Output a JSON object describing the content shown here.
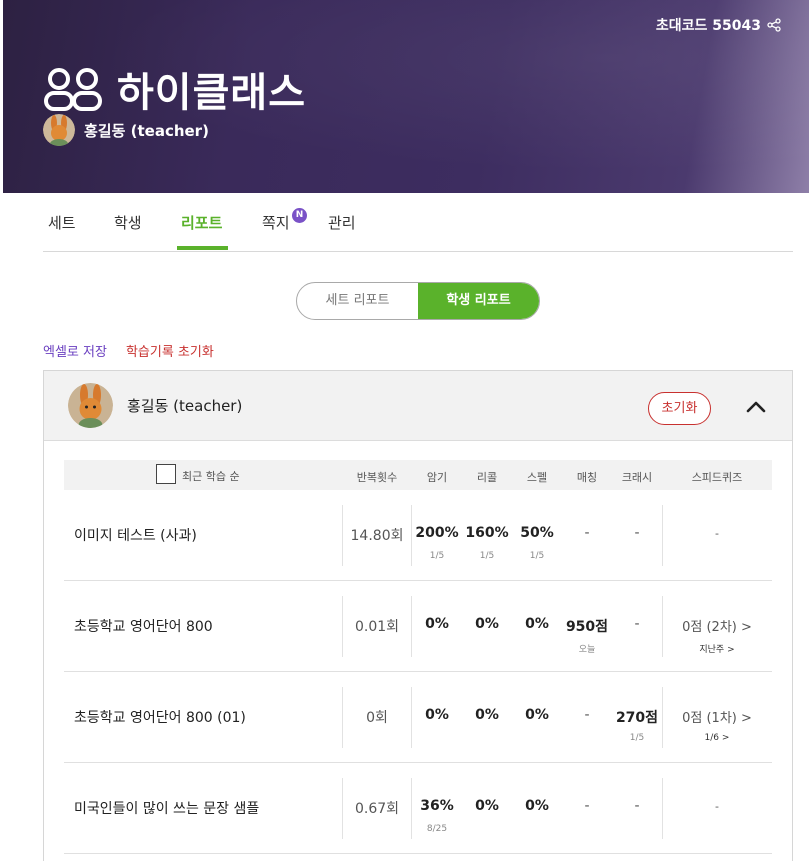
{
  "header": {
    "invite_label": "초대코드 55043",
    "brand": "하이클래스",
    "owner": "홍길동  (teacher)",
    "bg_color": "#3a2a5a"
  },
  "tabs": [
    {
      "label": "세트",
      "active": false
    },
    {
      "label": "학생",
      "active": false
    },
    {
      "label": "리포트",
      "active": true
    },
    {
      "label": "쪽지",
      "active": false,
      "badge": "N"
    },
    {
      "label": "관리",
      "active": false
    }
  ],
  "segment": {
    "set_report": "세트 리포트",
    "student_report": "학생 리포트",
    "active": "student_report"
  },
  "links": {
    "excel": "엑셀로 저장",
    "reset_records": "학습기록 초기화"
  },
  "student": {
    "name": "홍길동 (teacher)",
    "reset_button": "초기화"
  },
  "table": {
    "sort_label": "최근 학습 순",
    "columns": [
      "반복횟수",
      "암기",
      "리콜",
      "스펠",
      "매칭",
      "크래시",
      "스피드퀴즈"
    ],
    "rows": [
      {
        "title": "이미지 테스트 (사과)",
        "repeat": "14.80회",
        "memorize": "200%",
        "memorize_sub": "1/5",
        "recall": "160%",
        "recall_sub": "1/5",
        "spell": "50%",
        "spell_sub": "1/5",
        "matching": "-",
        "matching_sub": "",
        "crash": "-",
        "crash_sub": "",
        "speed": "-",
        "speed_sub": ""
      },
      {
        "title": "초등학교 영어단어 800",
        "repeat": "0.01회",
        "memorize": "0%",
        "memorize_sub": "",
        "recall": "0%",
        "recall_sub": "",
        "spell": "0%",
        "spell_sub": "",
        "matching": "950점",
        "matching_sub": "오늘",
        "crash": "-",
        "crash_sub": "",
        "speed": "0점 (2차) >",
        "speed_sub": "지난주 >"
      },
      {
        "title": "초등학교 영어단어 800 (01)",
        "repeat": "0회",
        "memorize": "0%",
        "memorize_sub": "",
        "recall": "0%",
        "recall_sub": "",
        "spell": "0%",
        "spell_sub": "",
        "matching": "-",
        "matching_sub": "",
        "crash": "270점",
        "crash_sub": "1/5",
        "speed": "0점 (1차) >",
        "speed_sub": "1/6 >"
      },
      {
        "title": "미국인들이 많이 쓰는 문장 샘플",
        "repeat": "0.67회",
        "memorize": "36%",
        "memorize_sub": "8/25",
        "recall": "0%",
        "recall_sub": "",
        "spell": "0%",
        "spell_sub": "",
        "matching": "-",
        "matching_sub": "",
        "crash": "-",
        "crash_sub": "",
        "speed": "-",
        "speed_sub": ""
      }
    ]
  },
  "colors": {
    "accent": "#5ab22b",
    "danger": "#c8312f",
    "link": "#6a3fc0",
    "badge": "#7a52c7"
  }
}
